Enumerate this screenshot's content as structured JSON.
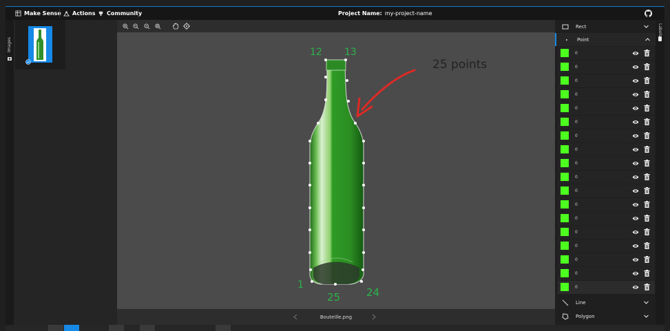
{
  "topbar": {
    "logo": "Make Sense",
    "actions": "Actions",
    "community": "Community",
    "project_name_label": "Project Name:",
    "project_name_value": "my-project-name"
  },
  "left_strip": {
    "label": "Images"
  },
  "right_strip": {
    "label": "Labels"
  },
  "editor": {
    "filename": "Bouteille.png",
    "annotation_numbers": {
      "left_top": "12",
      "right_top": "13",
      "bottom_left": "1",
      "bottom_mid": "25",
      "bottom_right": "24"
    },
    "annotation_note": "25 points"
  },
  "labels_panel": {
    "sections": {
      "rect": "Rect",
      "point": "Point",
      "line": "Line",
      "polygon": "Polygon"
    },
    "point_value": "0",
    "point_rows": [
      "0",
      "0",
      "0",
      "0",
      "0",
      "0",
      "0",
      "0",
      "0",
      "0",
      "0",
      "0",
      "0",
      "0",
      "0",
      "0",
      "0",
      "0"
    ],
    "swatch_color": "#4cff1e"
  },
  "colors": {
    "accent": "#1688e6",
    "canvas": "#4b4b4b",
    "annotation_green": "#2bb34a",
    "arrow_red": "#dd2a25"
  }
}
